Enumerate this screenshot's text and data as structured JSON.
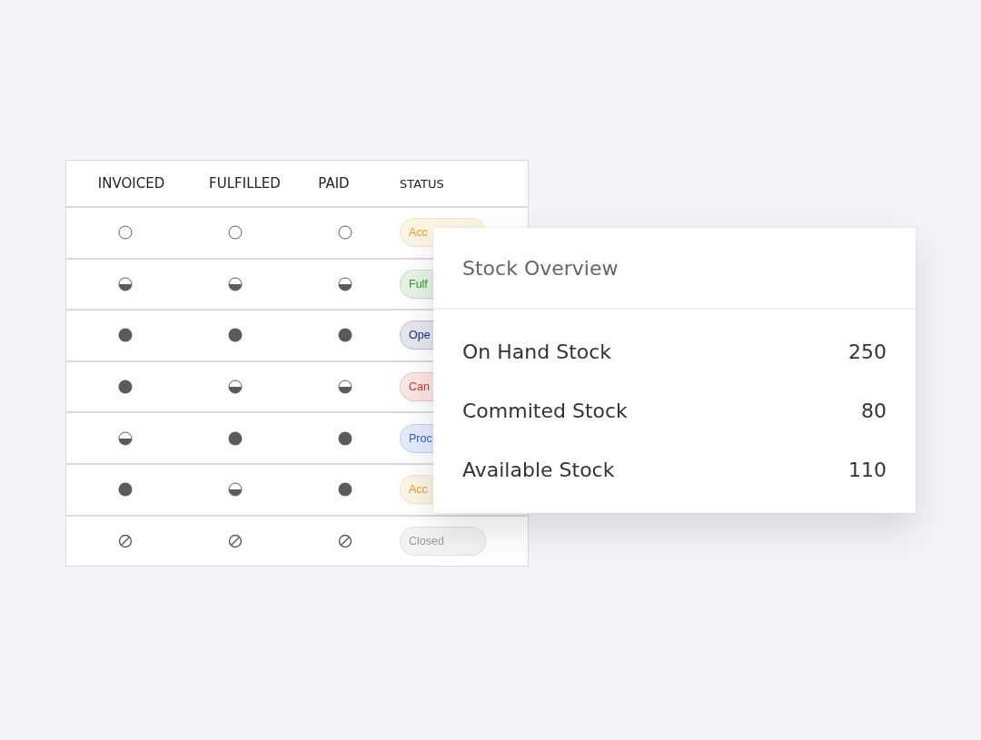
{
  "table": {
    "columns": [
      "INVOICED",
      "FULFILLED",
      "PAID",
      "STATUS"
    ],
    "rows": [
      {
        "marks": [
          {
            "kind": "empty"
          },
          {
            "kind": "empty"
          },
          {
            "kind": "empty"
          }
        ],
        "status": {
          "label": "Acc",
          "color": "#e8a020"
        }
      },
      {
        "marks": [
          {
            "kind": "half"
          },
          {
            "kind": "half"
          },
          {
            "kind": "half"
          }
        ],
        "status": {
          "label": "Fulf",
          "color": "#2a9a2a"
        }
      },
      {
        "marks": [
          {
            "kind": "full"
          },
          {
            "kind": "full"
          },
          {
            "kind": "full"
          }
        ],
        "status": {
          "label": "Ope",
          "color": "#1f2a7a"
        }
      },
      {
        "marks": [
          {
            "kind": "full"
          },
          {
            "kind": "half"
          },
          {
            "kind": "half"
          }
        ],
        "status": {
          "label": "Can",
          "color": "#d0342c"
        }
      },
      {
        "marks": [
          {
            "kind": "half"
          },
          {
            "kind": "full"
          },
          {
            "kind": "full"
          }
        ],
        "status": {
          "label": "Proc",
          "color": "#2f5fe0"
        }
      },
      {
        "marks": [
          {
            "kind": "full"
          },
          {
            "kind": "half"
          },
          {
            "kind": "full"
          }
        ],
        "status": {
          "label": "Acc",
          "color": "#e8a020"
        }
      },
      {
        "marks": [
          {
            "kind": "none"
          },
          {
            "kind": "none"
          },
          {
            "kind": "none"
          }
        ],
        "status": {
          "label": "Closed",
          "color": "#9a9a9a"
        }
      }
    ]
  },
  "stock_overview": {
    "title": "Stock Overview",
    "rows": [
      {
        "label": "On Hand Stock",
        "value": "250"
      },
      {
        "label": "Commited Stock",
        "value": "80"
      },
      {
        "label": "Available Stock",
        "value": "110"
      }
    ]
  }
}
